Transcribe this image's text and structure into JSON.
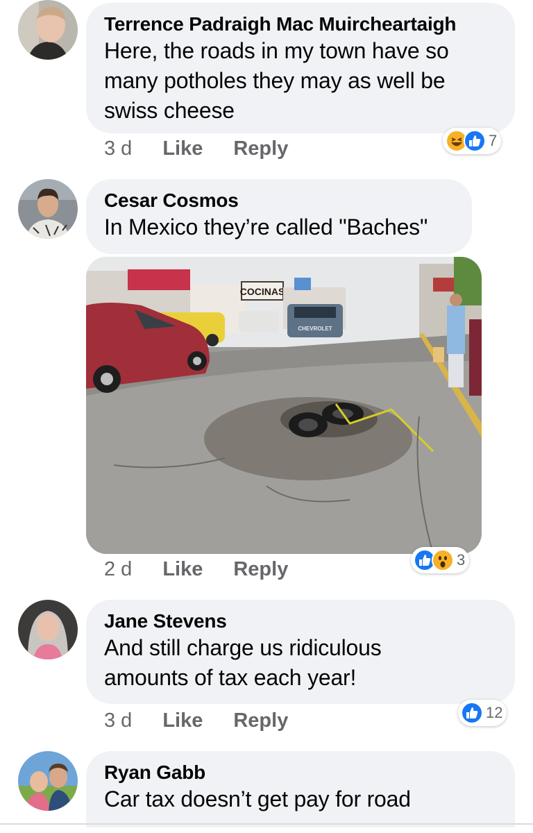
{
  "comments": [
    {
      "author": "Terrence Padraigh Mac Muircheartaigh",
      "lines": [
        "Here, the roads in my town have so",
        "many potholes they may as well be",
        "swiss cheese"
      ],
      "time": "3 d",
      "like_label": "Like",
      "reply_label": "Reply",
      "reactions": [
        "haha",
        "like"
      ],
      "reaction_count": "7"
    },
    {
      "author": "Cesar Cosmos",
      "lines": [
        "In Mexico they’re called \"Baches\""
      ],
      "time": "2 d",
      "like_label": "Like",
      "reply_label": "Reply",
      "reactions": [
        "like",
        "wow"
      ],
      "reaction_count": "3",
      "photo_signs": [
        "COCINAS",
        "CHEVROLET"
      ]
    },
    {
      "author": "Jane Stevens",
      "lines": [
        "And still charge us ridiculous",
        "amounts of tax each year!"
      ],
      "time": "3 d",
      "like_label": "Like",
      "reply_label": "Reply",
      "reactions": [
        "like"
      ],
      "reaction_count": "12"
    },
    {
      "author": "Ryan Gabb",
      "lines": [
        "Car tax doesn’t get pay for road"
      ]
    }
  ],
  "colors": {
    "bubble": "#f0f2f5",
    "meta_text": "#65676b",
    "like_blue": "#1877f2",
    "haha_yellow": "#f7b125"
  }
}
